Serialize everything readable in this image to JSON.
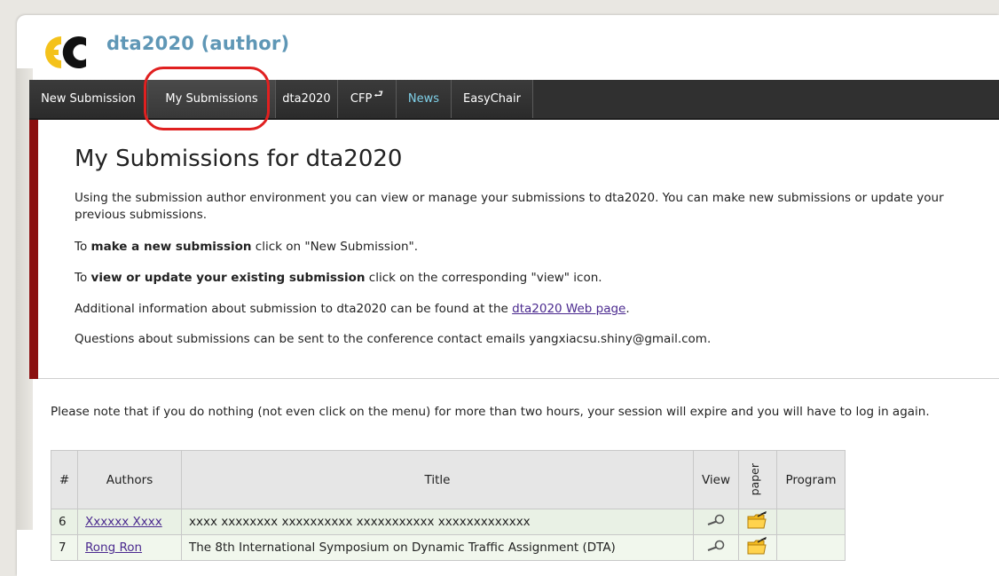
{
  "header": {
    "app_title": "dta2020 (author)",
    "logo_icon": "easychair-logo-icon"
  },
  "nav": {
    "items": [
      {
        "label": "New Submission"
      },
      {
        "label": "My Submissions"
      },
      {
        "label": "dta2020"
      },
      {
        "label": "CFP"
      },
      {
        "label": "News"
      },
      {
        "label": "EasyChair"
      }
    ],
    "cfp_icon": "external-return-icon"
  },
  "content": {
    "title": "My Submissions for dta2020",
    "intro": "Using the submission author environment you can view or manage your submissions to dta2020. You can make new submissions or update your previous submissions.",
    "new_prefix": "To ",
    "new_bold": "make a new submission",
    "new_suffix": " click on \"New Submission\".",
    "view_prefix": "To ",
    "view_bold": "view or update your existing submission",
    "view_suffix": " click on the corresponding \"view\" icon.",
    "info_prefix": "Additional information about submission to dta2020 can be found at the ",
    "info_link": "dta2020 Web page",
    "info_suffix": ".",
    "contact": "Questions about submissions can be sent to the conference contact emails yangxiacsu.shiny@gmail.com."
  },
  "note": "Please note that if you do nothing (not even click on the menu) for more than two hours, your session will expire and you will have to log in again.",
  "table": {
    "headers": {
      "num": "#",
      "authors": "Authors",
      "title": "Title",
      "view": "View",
      "paper": "paper",
      "program": "Program"
    },
    "rows": [
      {
        "num": "6",
        "authors": "Xxxxxx Xxxx",
        "title": "xxxx xxxxxxxx xxxxxxxxxx xxxxxxxxxxx xxxxxxxxxxxxx",
        "view_icon": "magnifier-icon",
        "paper_icon": "folder-upload-icon",
        "program": ""
      },
      {
        "num": "7",
        "authors": "Rong Ron",
        "title": "The 8th International Symposium on Dynamic Traffic Assignment (DTA)",
        "view_icon": "magnifier-icon",
        "paper_icon": "folder-upload-icon",
        "program": ""
      }
    ]
  },
  "colors": {
    "title_blue": "#5f97b6",
    "nav_bg": "#303030",
    "news_text": "#7fd0e8",
    "accent_bar": "#8b1010",
    "highlight_red": "#e02020",
    "link": "#4b2a8f"
  }
}
